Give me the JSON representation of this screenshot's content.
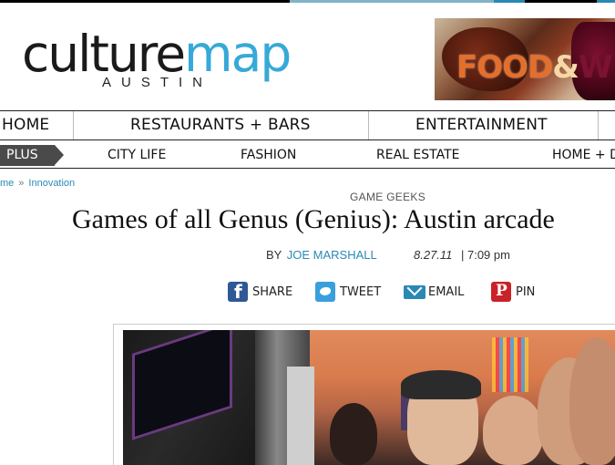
{
  "site": {
    "logo_main_1": "culture",
    "logo_main_2": "map",
    "logo_city": "AUSTIN"
  },
  "ad": {
    "text_1": "FOOD",
    "text_2": "&",
    "text_3": "W"
  },
  "nav_primary": [
    {
      "label": "HOME"
    },
    {
      "label": "RESTAURANTS + BARS"
    },
    {
      "label": "ENTERTAINMENT"
    }
  ],
  "nav_secondary": {
    "plus": "PLUS",
    "items": [
      {
        "label": "CITY LIFE"
      },
      {
        "label": "FASHION"
      },
      {
        "label": "REAL ESTATE"
      },
      {
        "label": "HOME + D"
      }
    ]
  },
  "breadcrumb": {
    "home": "me",
    "separator": "»",
    "section": "Innovation"
  },
  "article": {
    "kicker": "GAME GEEKS",
    "headline": "Games of all Genus (Genius): Austin arcade",
    "by": "BY",
    "author": "JOE MARSHALL",
    "date": "8.27.11",
    "time": "| 7:09 pm"
  },
  "share": {
    "facebook": "SHARE",
    "twitter": "TWEET",
    "email": "EMAIL",
    "pinterest": "PIN"
  },
  "colors": {
    "accent": "#36a9d8",
    "link": "#2a89b4",
    "facebook": "#2f5896",
    "twitter": "#3a9fdd",
    "pinterest": "#c92228"
  }
}
